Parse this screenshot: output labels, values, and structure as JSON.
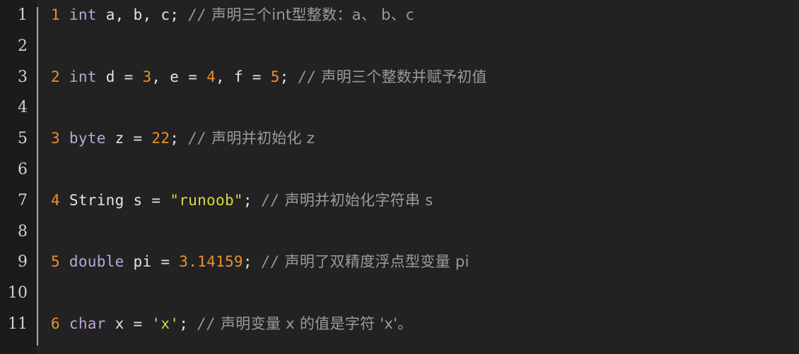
{
  "editor": {
    "name": "code-snippet-viewer",
    "background": "#222222",
    "gutter_background": "#1b1b1b",
    "divider_color": "#a8a8a8",
    "language": "java",
    "colors": {
      "keyword": "#b9a7d8",
      "number": "#e8912d",
      "string": "#d7d844",
      "comment": "#9b9b9b",
      "plain": "#e3e3e3",
      "step_number": "#e8912d",
      "line_number": "#d6d2cb"
    }
  },
  "gutter": {
    "line_numbers": [
      "1",
      "2",
      "3",
      "4",
      "5",
      "6",
      "7",
      "8",
      "9",
      "10",
      "11"
    ]
  },
  "lines": [
    {
      "gutter": "1",
      "step": "1",
      "blank": false,
      "tokens": [
        {
          "text": "1",
          "type": "step"
        },
        {
          "text": " ",
          "type": "plain"
        },
        {
          "text": "int",
          "type": "keyword"
        },
        {
          "text": " a, b, c; ",
          "type": "plain"
        },
        {
          "text": "//",
          "type": "comment-slash"
        },
        {
          "text": " 声明三个int型整数：a、 b、c",
          "type": "comment"
        }
      ]
    },
    {
      "gutter": "2",
      "step": "",
      "blank": true,
      "tokens": []
    },
    {
      "gutter": "3",
      "step": "2",
      "blank": false,
      "tokens": [
        {
          "text": "2",
          "type": "step"
        },
        {
          "text": " ",
          "type": "plain"
        },
        {
          "text": "int",
          "type": "keyword"
        },
        {
          "text": " d = ",
          "type": "plain"
        },
        {
          "text": "3",
          "type": "number"
        },
        {
          "text": ", e = ",
          "type": "plain"
        },
        {
          "text": "4",
          "type": "number"
        },
        {
          "text": ", f = ",
          "type": "plain"
        },
        {
          "text": "5",
          "type": "number"
        },
        {
          "text": "; ",
          "type": "plain"
        },
        {
          "text": "//",
          "type": "comment-slash"
        },
        {
          "text": " 声明三个整数并赋予初值",
          "type": "comment"
        }
      ]
    },
    {
      "gutter": "4",
      "step": "",
      "blank": true,
      "tokens": []
    },
    {
      "gutter": "5",
      "step": "3",
      "blank": false,
      "tokens": [
        {
          "text": "3",
          "type": "step"
        },
        {
          "text": " ",
          "type": "plain"
        },
        {
          "text": "byte",
          "type": "keyword"
        },
        {
          "text": " z = ",
          "type": "plain"
        },
        {
          "text": "22",
          "type": "number"
        },
        {
          "text": "; ",
          "type": "plain"
        },
        {
          "text": "//",
          "type": "comment-slash"
        },
        {
          "text": " 声明并初始化 z",
          "type": "comment"
        }
      ]
    },
    {
      "gutter": "6",
      "step": "",
      "blank": true,
      "tokens": []
    },
    {
      "gutter": "7",
      "step": "4",
      "blank": false,
      "tokens": [
        {
          "text": "4",
          "type": "step"
        },
        {
          "text": " String s = ",
          "type": "plain"
        },
        {
          "text": "\"runoob\"",
          "type": "string"
        },
        {
          "text": "; ",
          "type": "plain"
        },
        {
          "text": "//",
          "type": "comment-slash"
        },
        {
          "text": " 声明并初始化字符串 s",
          "type": "comment"
        }
      ]
    },
    {
      "gutter": "8",
      "step": "",
      "blank": true,
      "tokens": []
    },
    {
      "gutter": "9",
      "step": "5",
      "blank": false,
      "tokens": [
        {
          "text": "5",
          "type": "step"
        },
        {
          "text": " ",
          "type": "plain"
        },
        {
          "text": "double",
          "type": "keyword"
        },
        {
          "text": " pi = ",
          "type": "plain"
        },
        {
          "text": "3.14159",
          "type": "number"
        },
        {
          "text": "; ",
          "type": "plain"
        },
        {
          "text": "//",
          "type": "comment-slash"
        },
        {
          "text": " 声明了双精度浮点型变量 pi",
          "type": "comment"
        }
      ]
    },
    {
      "gutter": "10",
      "step": "",
      "blank": true,
      "tokens": []
    },
    {
      "gutter": "11",
      "step": "6",
      "blank": false,
      "tokens": [
        {
          "text": "6",
          "type": "step"
        },
        {
          "text": " ",
          "type": "plain"
        },
        {
          "text": "char",
          "type": "keyword"
        },
        {
          "text": " x = ",
          "type": "plain"
        },
        {
          "text": "'x'",
          "type": "string"
        },
        {
          "text": "; ",
          "type": "plain"
        },
        {
          "text": "//",
          "type": "comment-slash"
        },
        {
          "text": " 声明变量 x 的值是字符 'x'。",
          "type": "comment"
        }
      ]
    }
  ]
}
